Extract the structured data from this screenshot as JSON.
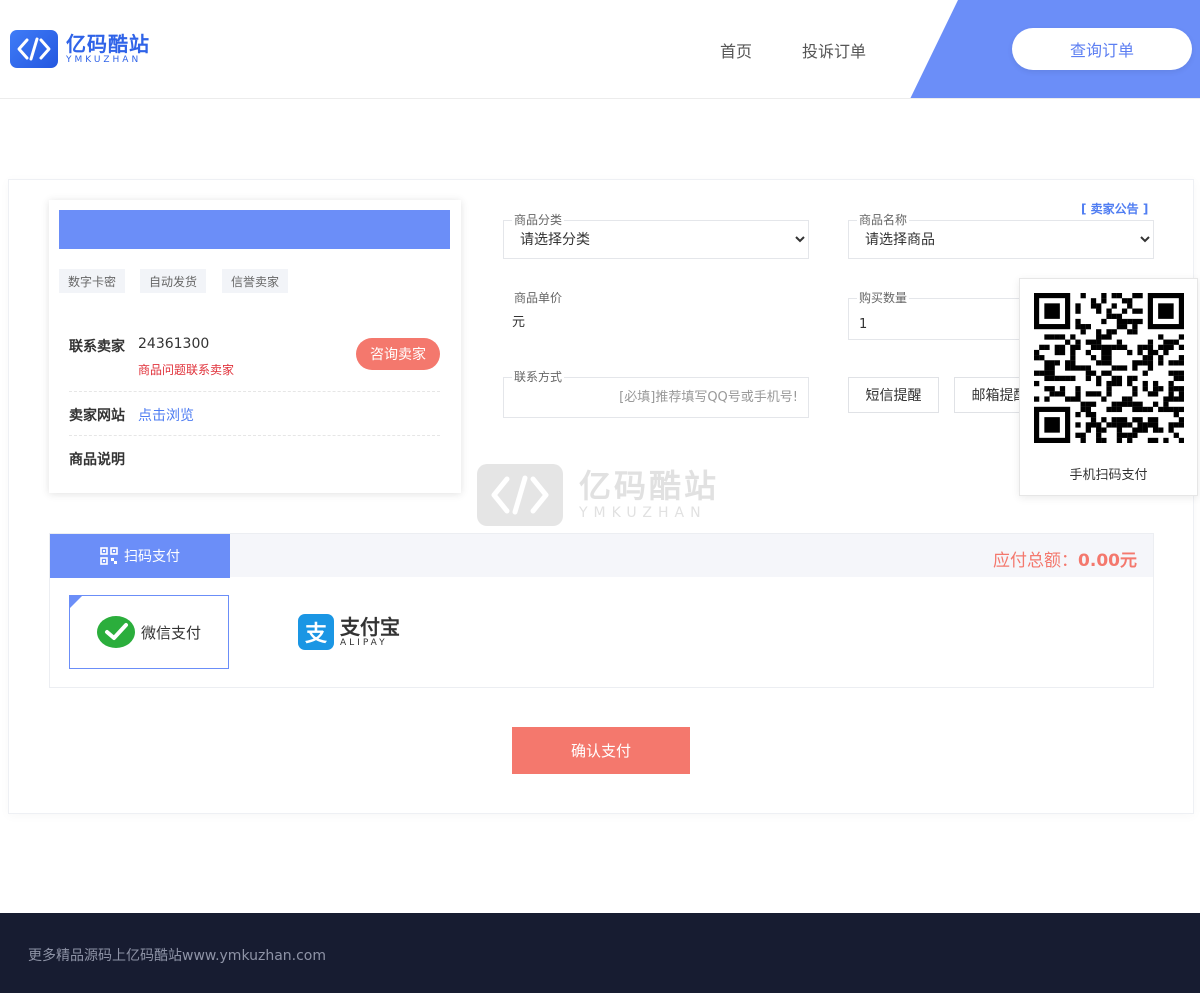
{
  "header": {
    "logo_cn": "亿码酷站",
    "logo_en": "YMKUZHAN",
    "nav": [
      {
        "label": "首页"
      },
      {
        "label": "投诉订单"
      }
    ],
    "query_label": "查询订单"
  },
  "seller": {
    "tags": [
      "数字卡密",
      "自动发货",
      "信誉卖家"
    ],
    "contact_label": "联系卖家",
    "contact_value": "24361300",
    "contact_hint": "商品问题联系卖家",
    "consult_label": "咨询卖家",
    "website_label": "卖家网站",
    "website_link": "点击浏览",
    "desc_label": "商品说明"
  },
  "form": {
    "notice_link": "[ 卖家公告 ]",
    "category_label": "商品分类",
    "category_value": "请选择分类",
    "product_label": "商品名称",
    "product_value": "请选择商品",
    "price_label": "商品单价",
    "price_value": "元",
    "qty_label": "购买数量",
    "qty_value": "1",
    "contact_label": "联系方式",
    "contact_placeholder": "[必填]推荐填写QQ号或手机号!",
    "sms_label": "短信提醒",
    "email_label": "邮箱提醒"
  },
  "watermark": {
    "cn": "亿码酷站",
    "en": "YMKUZHAN"
  },
  "qr": {
    "caption": "手机扫码支付"
  },
  "payment": {
    "tab_label": "扫码支付",
    "total_label": "应付总额：",
    "total_value": "0.00元",
    "wechat_label": "微信支付",
    "alipay_cn": "支付宝",
    "alipay_en": "ALIPAY",
    "alipay_glyph": "支",
    "confirm_label": "确认支付"
  },
  "footer": {
    "text": "更多精品源码上亿码酷站www.ymkuzhan.com"
  },
  "colors": {
    "primary": "#6b8ef8",
    "accent": "#f4786d",
    "link": "#4f7df2",
    "warning": "#e0313a",
    "footer_bg": "#171c31"
  }
}
